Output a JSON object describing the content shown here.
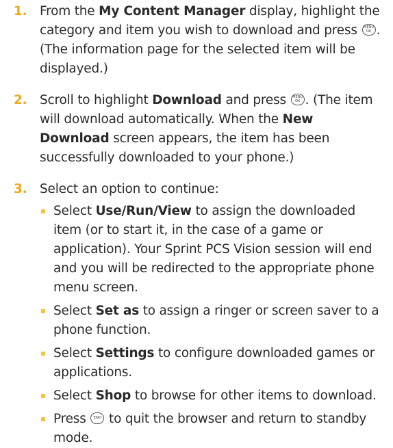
{
  "colors": {
    "number": "#f0a81c",
    "bullet": "#f5c542",
    "text": "#2b2b2b"
  },
  "keys": {
    "menu_ok": {
      "line1": "MENU",
      "line2": "OK",
      "icon": "menu-ok-key-icon"
    },
    "end": {
      "line1": "END",
      "icon": "end-key-icon"
    }
  },
  "step1": {
    "number": "1.",
    "t1": "From the ",
    "b1": "My Content Manager",
    "t2": " display, highlight the category and item you wish to download and press ",
    "t3": ". (The information page for the selected item will be displayed.)"
  },
  "step2": {
    "number": "2.",
    "t1": "Scroll to highlight ",
    "b1": "Download",
    "t2": " and press ",
    "t3": ". (The item will download automatically. When the ",
    "b2": "New Download",
    "t4": " screen appears, the item has been successfully downloaded to your phone.)"
  },
  "step3": {
    "number": "3.",
    "text": "Select an option to continue:",
    "bullet1": {
      "t1": "Select ",
      "b1": "Use/Run/View",
      "t2": " to assign the downloaded item (or to start it, in the case of a game or application). Your Sprint PCS Vision session will end and you will be redirected to the appropriate phone menu screen."
    },
    "bullet2": {
      "t1": "Select ",
      "b1": "Set as",
      "t2": " to assign a ringer or screen saver to a phone function."
    },
    "bullet3": {
      "t1": "Select ",
      "b1": "Settings",
      "t2": " to configure downloaded games or applications."
    },
    "bullet4": {
      "t1": "Select ",
      "b1": "Shop",
      "t2": " to browse for other items to download."
    },
    "bullet5": {
      "t1": "Press ",
      "t2": " to quit the browser and return to standby mode."
    }
  }
}
